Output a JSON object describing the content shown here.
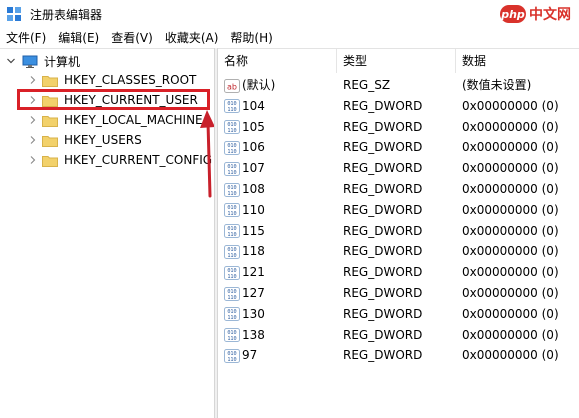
{
  "window": {
    "title": "注册表编辑器",
    "watermark_logo": "php",
    "watermark_text": "中文网"
  },
  "menu": [
    "文件(F)",
    "编辑(E)",
    "查看(V)",
    "收藏夹(A)",
    "帮助(H)"
  ],
  "tree": {
    "root_label": "计算机",
    "keys": [
      {
        "label": "HKEY_CLASSES_ROOT"
      },
      {
        "label": "HKEY_CURRENT_USER"
      },
      {
        "label": "HKEY_LOCAL_MACHINE"
      },
      {
        "label": "HKEY_USERS"
      },
      {
        "label": "HKEY_CURRENT_CONFIG"
      }
    ],
    "highlighted_key": "HKEY_CURRENT_USER"
  },
  "list": {
    "headers": {
      "name": "名称",
      "type": "类型",
      "data": "数据"
    },
    "rows": [
      {
        "icon": "string-value-icon",
        "name": "(默认)",
        "type": "REG_SZ",
        "data": "(数值未设置)"
      },
      {
        "icon": "binary-value-icon",
        "name": "104",
        "type": "REG_DWORD",
        "data": "0x00000000 (0)"
      },
      {
        "icon": "binary-value-icon",
        "name": "105",
        "type": "REG_DWORD",
        "data": "0x00000000 (0)"
      },
      {
        "icon": "binary-value-icon",
        "name": "106",
        "type": "REG_DWORD",
        "data": "0x00000000 (0)"
      },
      {
        "icon": "binary-value-icon",
        "name": "107",
        "type": "REG_DWORD",
        "data": "0x00000000 (0)"
      },
      {
        "icon": "binary-value-icon",
        "name": "108",
        "type": "REG_DWORD",
        "data": "0x00000000 (0)"
      },
      {
        "icon": "binary-value-icon",
        "name": "110",
        "type": "REG_DWORD",
        "data": "0x00000000 (0)"
      },
      {
        "icon": "binary-value-icon",
        "name": "115",
        "type": "REG_DWORD",
        "data": "0x00000000 (0)"
      },
      {
        "icon": "binary-value-icon",
        "name": "118",
        "type": "REG_DWORD",
        "data": "0x00000000 (0)"
      },
      {
        "icon": "binary-value-icon",
        "name": "121",
        "type": "REG_DWORD",
        "data": "0x00000000 (0)"
      },
      {
        "icon": "binary-value-icon",
        "name": "127",
        "type": "REG_DWORD",
        "data": "0x00000000 (0)"
      },
      {
        "icon": "binary-value-icon",
        "name": "130",
        "type": "REG_DWORD",
        "data": "0x00000000 (0)"
      },
      {
        "icon": "binary-value-icon",
        "name": "138",
        "type": "REG_DWORD",
        "data": "0x00000000 (0)"
      },
      {
        "icon": "binary-value-icon",
        "name": "97",
        "type": "REG_DWORD",
        "data": "0x00000000 (0)"
      }
    ]
  },
  "colors": {
    "highlight_box": "#d92027",
    "arrow": "#c8202b",
    "folder": "#f2d16b",
    "watermark": "#d9322b"
  }
}
